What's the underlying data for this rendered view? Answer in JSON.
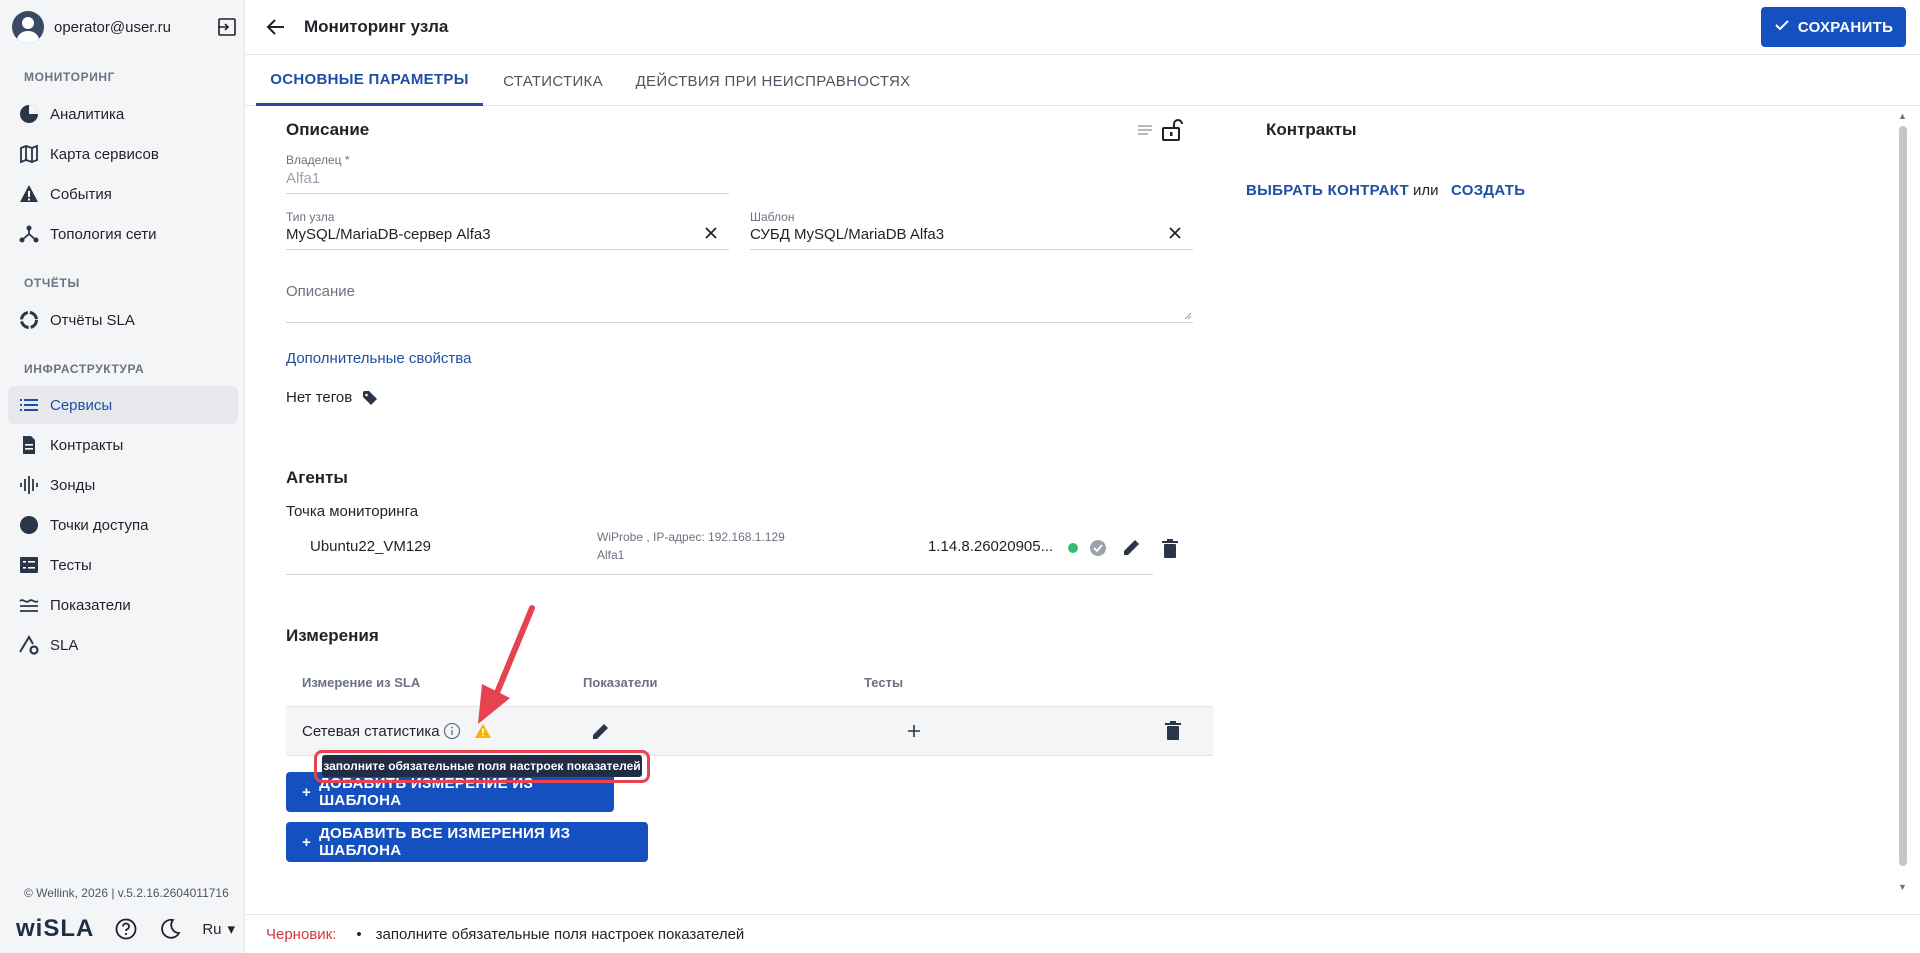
{
  "user": {
    "email": "operator@user.ru"
  },
  "sidebar": {
    "sections": [
      {
        "title": "МОНИТОРИНГ",
        "items": [
          "Аналитика",
          "Карта сервисов",
          "События",
          "Топология сети"
        ]
      },
      {
        "title": "ОТЧЁТЫ",
        "items": [
          "Отчёты SLA"
        ]
      },
      {
        "title": "ИНФРАСТРУКТУРА",
        "items": [
          "Сервисы",
          "Контракты",
          "Зонды",
          "Точки доступа",
          "Тесты",
          "Показатели",
          "SLA"
        ]
      }
    ],
    "active_item": "Сервисы",
    "footer": "© Wellink, 2026 | v.5.2.16.2604011716",
    "brand": "wiSLA",
    "lang": "Ru"
  },
  "header": {
    "title": "Мониторинг узла",
    "save_label": "СОХРАНИТЬ"
  },
  "tabs": [
    "ОСНОВНЫЕ ПАРАМЕТРЫ",
    "СТАТИСТИКА",
    "ДЕЙСТВИЯ ПРИ НЕИСПРАВНОСТЯХ"
  ],
  "description": {
    "title": "Описание",
    "owner_label": "Владелец *",
    "owner_value": "Alfa1",
    "node_type_label": "Тип узла",
    "node_type_value": "MySQL/MariaDB-сервер Alfa3",
    "template_label": "Шаблон",
    "template_value": "СУБД MySQL/MariaDB Alfa3",
    "description_placeholder": "Описание",
    "extra_props_link": "Дополнительные свойства",
    "tags_text": "Нет тегов"
  },
  "contracts": {
    "title": "Контракты",
    "select_label": "ВЫБРАТЬ КОНТРАКТ",
    "or_label": "или",
    "create_label": "СОЗДАТЬ"
  },
  "agents": {
    "title": "Агенты",
    "subtitle": "Точка мониторинга",
    "rows": [
      {
        "name": "Ubuntu22_VM129",
        "info_line1": "WiProbe , IP-адрес: 192.168.1.129",
        "info_line2": "Alfa1",
        "version": "1.14.8.26020905..."
      }
    ]
  },
  "measurements": {
    "title": "Измерения",
    "columns": [
      "Измерение из SLA",
      "Показатели",
      "Тесты"
    ],
    "rows": [
      {
        "name": "Сетевая статистика"
      }
    ],
    "tooltip": "заполните обязательные поля настроек показателей",
    "add_one_label": "ДОБАВИТЬ ИЗМЕРЕНИЕ ИЗ ШАБЛОНА",
    "add_all_label": "ДОБАВИТЬ ВСЕ ИЗМЕРЕНИЯ ИЗ ШАБЛОНА"
  },
  "status": {
    "draft_label": "Черновик:",
    "message": "заполните обязательные поля настроек показателей"
  },
  "colors": {
    "accent": "#1550c0",
    "warning": "#f5b400",
    "success": "#2fbf71",
    "error": "#d03a3a",
    "annotation": "#e5434f"
  }
}
